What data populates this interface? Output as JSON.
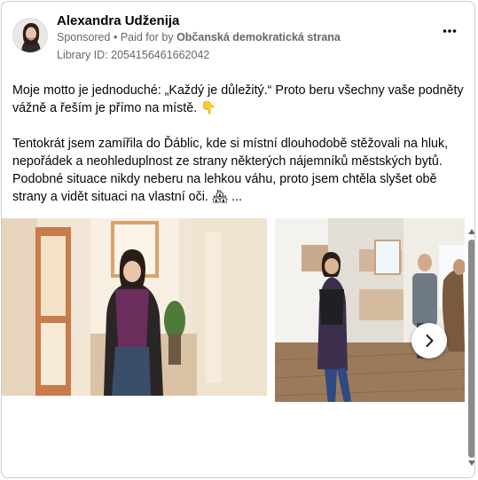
{
  "ad": {
    "advertiser_name": "Alexandra Udženija",
    "sponsored_label": "Sponsored",
    "paid_for_prefix": "Paid for by",
    "paid_for_by": "Občanská demokratická strana",
    "library_id": "Library ID: 2054156461662042",
    "more_options_icon": "more-horizontal-icon",
    "body_paragraph_1": "Moje motto je jednoduché: „Každý je důležitý.“ Proto beru všechny vaše podněty vážně a řeším je přímo na místě. 👇",
    "body_paragraph_2": "Tentokrát jsem zamířila do Ďáblic, kde si místní dlouhodobě stěžovali na hluk, nepořádek a neohleduplnost ze strany některých nájemníků městských bytů. Podobné situace nikdy neberu na lehkou váhu, proto jsem chtěla slyšet obě strany a vidět situaci na vlastní oči. 🏘 ..."
  },
  "carousel": {
    "next_icon": "chevron-right-icon"
  },
  "colors": {
    "text_primary": "#050505",
    "text_secondary": "#65676b",
    "border": "#c9ccd1"
  }
}
